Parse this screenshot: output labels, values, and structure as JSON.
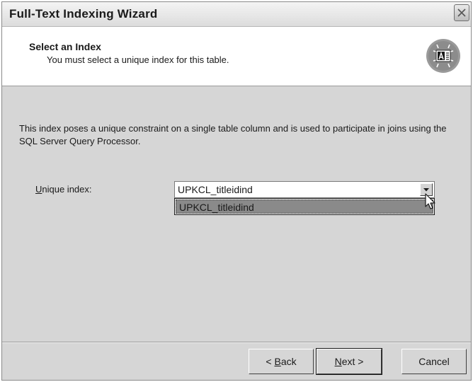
{
  "window": {
    "title": "Full-Text Indexing Wizard"
  },
  "header": {
    "title": "Select an Index",
    "subtitle": "You must select a unique index for this table."
  },
  "body": {
    "description": "This index poses a unique constraint on a single table column and is used to participate in joins using the SQL Server Query Processor.",
    "unique_index_label": {
      "accelerator": "U",
      "rest": "nique index:"
    },
    "unique_index_value": "UPKCL_titleidind",
    "dropdown_options": [
      "UPKCL_titleidind"
    ]
  },
  "buttons": {
    "back": {
      "accelerator": "B",
      "prefix": "< ",
      "rest": "ack"
    },
    "next": {
      "accelerator": "N",
      "rest": "ext >"
    },
    "cancel": "Cancel"
  },
  "icons": {
    "close": "close-icon",
    "wizard": "wizard-badge-icon",
    "dropdown": "chevron-down-icon",
    "cursor": "mouse-pointer-icon"
  },
  "colors": {
    "dialog_bg": "#d6d6d6",
    "selected_option_bg": "#8a8a8a"
  }
}
